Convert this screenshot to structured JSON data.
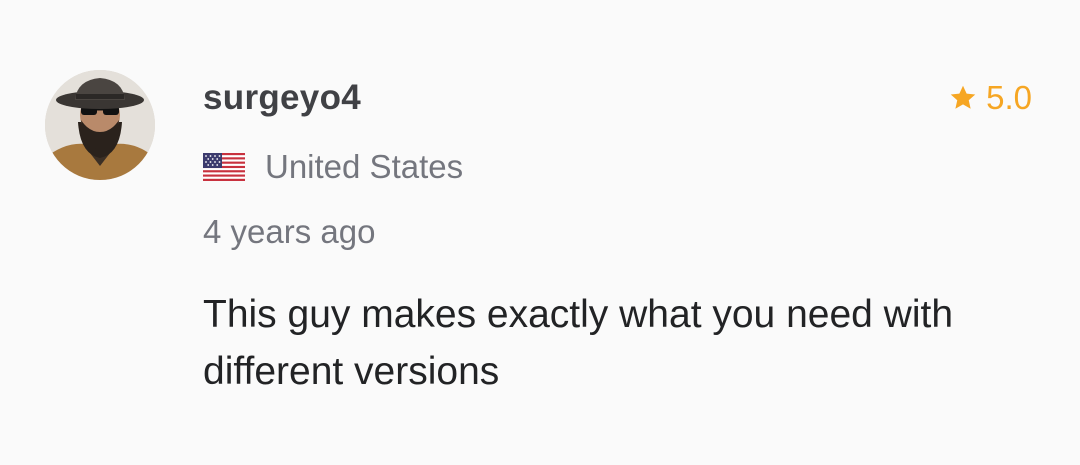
{
  "review": {
    "username": "surgeyo4",
    "rating": "5.0",
    "country": "United States",
    "time_ago": "4 years ago",
    "text": "This guy makes exactly what you need with different versions"
  },
  "icons": {
    "rating": "star-icon",
    "country": "us-flag-icon",
    "avatar": "user-avatar"
  },
  "colors": {
    "rating_accent": "#f6a623",
    "username": "#404145",
    "secondary_text": "#74767e",
    "body_text": "#222325"
  }
}
